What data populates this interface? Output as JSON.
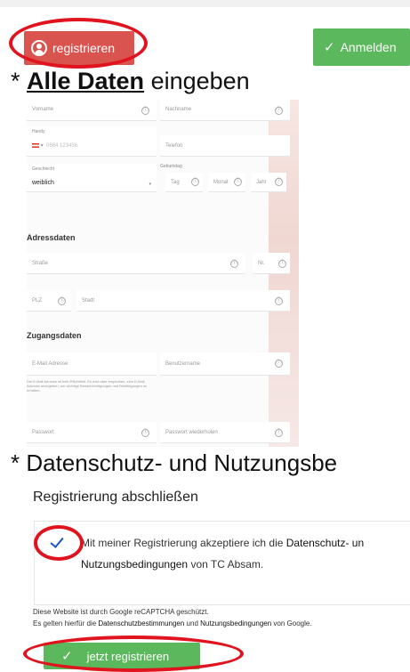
{
  "top": {
    "register_label": "registrieren",
    "login_label": "Anmelden"
  },
  "heading1": {
    "prefix": "* ",
    "bold": "Alle Daten",
    "rest": " eingeben"
  },
  "form": {
    "vorname": "Vorname",
    "nachname": "Nachname",
    "handy_label": "Handy",
    "handy_placeholder": "0664 123456",
    "telefon": "Telefon",
    "geschlecht_label": "Geschlecht",
    "geschlecht_value": "weiblich",
    "geburtstag_label": "Geburtstag",
    "tag": "Tag",
    "monat": "Monat",
    "jahr": "Jahr",
    "adressdaten": "Adressdaten",
    "strasse": "Straße",
    "nr": "Nr.",
    "plz": "PLZ",
    "stadt": "Stadt",
    "zugangsdaten": "Zugangsdaten",
    "email": "E-Mail Adresse",
    "benutzername": "Benutzername",
    "note": "Die E-Mail Adresse ist kein Pflichtfeld. Es wird aber empfohlen, eine E-Mail Adresse anzugeben, um wichtige Benachrichtigungen und Bestätigungen zu erhalten.",
    "passwort": "Passwort",
    "passwort2": "Passwort wiederholen",
    "info": "ⓘ"
  },
  "heading2": "* Datenschutz- und Nutzungsbe",
  "panel": {
    "title": "Registrierung abschließen",
    "consent_1": "Mit meiner Registrierung akzeptiere ich die ",
    "consent_link1": "Datenschutz- un",
    "consent_link2": "Nutzungsbedingungen",
    "consent_2": " von TC Absam.",
    "captcha_1": "Diese Website ist durch Google reCAPTCHA geschützt.",
    "captcha_2a": "Es gelten hierfür die ",
    "captcha_link1": "Datenschutzbestimmungen",
    "captcha_2b": " und ",
    "captcha_link2": "Nutzungsbedingungen",
    "captcha_2c": " von Google.",
    "submit_label": "jetzt registrieren"
  },
  "colors": {
    "red": "#d9534f",
    "green": "#5cb85c",
    "annotation": "#e0141e",
    "check": "#1a56c5"
  }
}
